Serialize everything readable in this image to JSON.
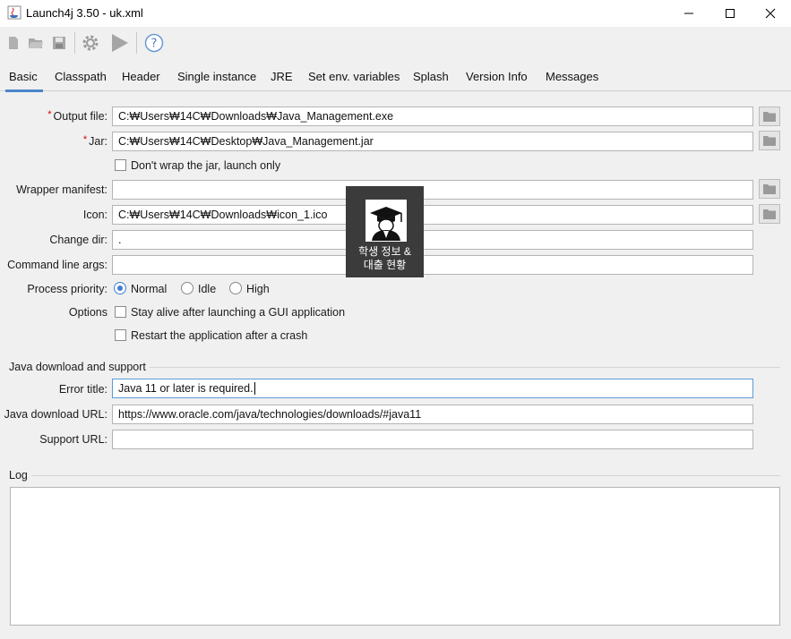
{
  "window": {
    "title": "Launch4j 3.50 - uk.xml",
    "minimize_icon": "minimize-icon",
    "maximize_icon": "maximize-icon",
    "close_icon": "close-icon"
  },
  "toolbar": {
    "buttons": [
      {
        "name": "new-file-icon"
      },
      {
        "name": "open-folder-icon"
      },
      {
        "name": "save-icon"
      },
      {
        "name": "gear-icon"
      },
      {
        "name": "run-icon"
      },
      {
        "name": "help-icon"
      }
    ]
  },
  "tabs": [
    "Basic",
    "Classpath",
    "Header",
    "Single instance",
    "JRE",
    "Set env. variables",
    "Splash",
    "Version Info",
    "Messages"
  ],
  "basic": {
    "output_file": {
      "label": "Output file:",
      "value": "C:₩Users₩14C₩Downloads₩Java_Management.exe"
    },
    "jar": {
      "label": "Jar:",
      "value": "C:₩Users₩14C₩Desktop₩Java_Management.jar"
    },
    "dont_wrap": "Don't wrap the jar, launch only",
    "wrapper_manifest": {
      "label": "Wrapper manifest:",
      "value": ""
    },
    "icon": {
      "label": "Icon:",
      "value": "C:₩Users₩14C₩Downloads₩icon_1.ico"
    },
    "change_dir": {
      "label": "Change dir:",
      "value": "."
    },
    "cmd_args": {
      "label": "Command line args:",
      "value": ""
    },
    "priority": {
      "label": "Process priority:",
      "options": [
        "Normal",
        "Idle",
        "High"
      ],
      "selected": "Normal"
    },
    "options": {
      "label": "Options",
      "stay_alive": "Stay alive after launching a GUI application",
      "restart": "Restart the application after a crash"
    }
  },
  "java_download": {
    "group_title": "Java download and support",
    "error_title": {
      "label": "Error title:",
      "value": "Java 11 or later is required."
    },
    "download_url": {
      "label": "Java download URL:",
      "value": "https://www.oracle.com/java/technologies/downloads/#java11"
    },
    "support_url": {
      "label": "Support URL:",
      "value": ""
    }
  },
  "log": {
    "title": "Log"
  },
  "tooltip": {
    "line1": "학생 정보 &",
    "line2": "대출 현황"
  },
  "colors": {
    "accent": "#4a86c8",
    "required": "#d40000"
  }
}
